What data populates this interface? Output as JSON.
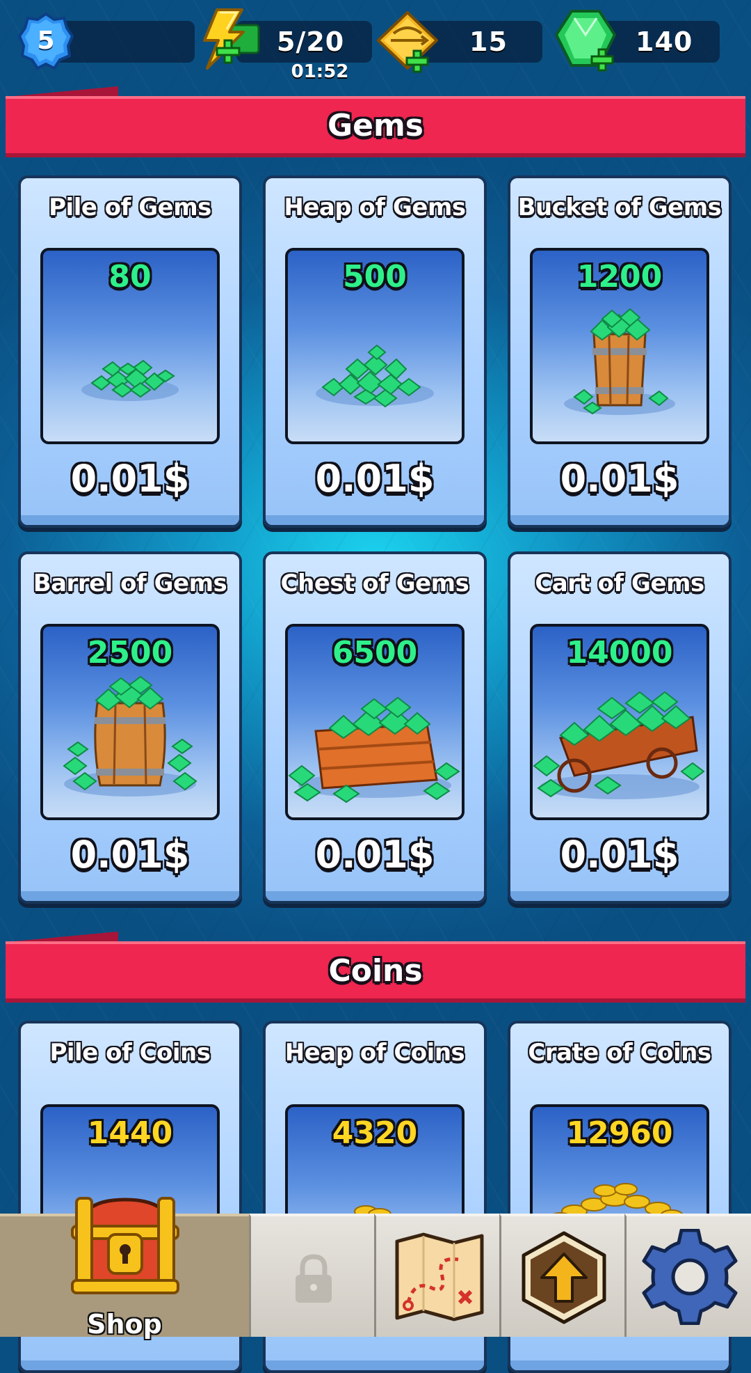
{
  "topbar": {
    "level": "5",
    "energy": "5/20",
    "energy_timer": "01:52",
    "arrows": "15",
    "gems": "140"
  },
  "sections": {
    "gems_title": "Gems",
    "coins_title": "Coins"
  },
  "gem_cards": [
    {
      "title": "Pile of Gems",
      "amount": "80",
      "price": "0.01$"
    },
    {
      "title": "Heap of Gems",
      "amount": "500",
      "price": "0.01$"
    },
    {
      "title": "Bucket of Gems",
      "amount": "1200",
      "price": "0.01$"
    },
    {
      "title": "Barrel of Gems",
      "amount": "2500",
      "price": "0.01$"
    },
    {
      "title": "Chest of Gems",
      "amount": "6500",
      "price": "0.01$"
    },
    {
      "title": "Cart of Gems",
      "amount": "14000",
      "price": "0.01$"
    }
  ],
  "coin_cards": [
    {
      "title": "Pile of Coins",
      "amount": "1440"
    },
    {
      "title": "Heap of Coins",
      "amount": "4320"
    },
    {
      "title": "Crate of Coins",
      "amount": "12960"
    }
  ],
  "nav": {
    "shop_label": "Shop",
    "items": [
      "chest-icon",
      "lock-icon",
      "map-icon",
      "upgrade-arrow-icon",
      "gear-icon"
    ]
  },
  "colors": {
    "banner": "#ee2650",
    "gem_amount": "#2ef08a",
    "coin_amount": "#ffd623"
  }
}
